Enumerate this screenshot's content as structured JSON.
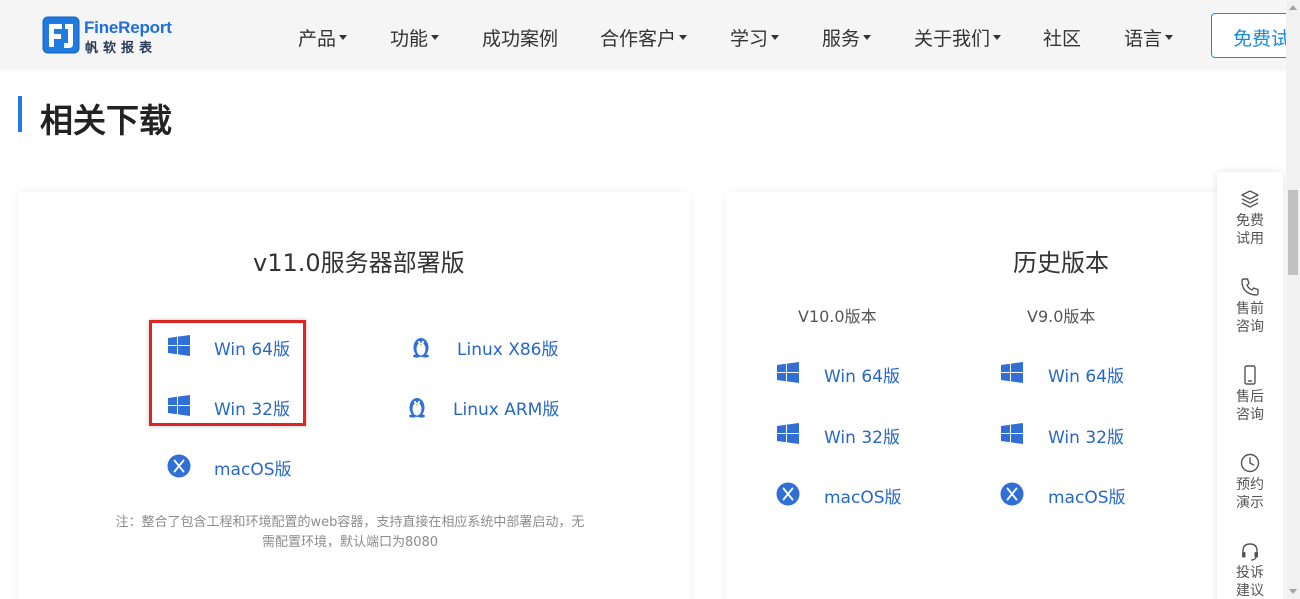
{
  "header": {
    "logo": {
      "en": "FineReport",
      "cn": "帆软报表"
    },
    "nav": [
      {
        "label": "产品",
        "dropdown": true
      },
      {
        "label": "功能",
        "dropdown": true
      },
      {
        "label": "成功案例",
        "dropdown": false
      },
      {
        "label": "合作客户",
        "dropdown": true
      },
      {
        "label": "学习",
        "dropdown": true
      },
      {
        "label": "服务",
        "dropdown": true
      },
      {
        "label": "关于我们",
        "dropdown": true
      },
      {
        "label": "社区",
        "dropdown": false
      },
      {
        "label": "语言",
        "dropdown": true
      }
    ],
    "trial_button": "免费试"
  },
  "page": {
    "title": "相关下载"
  },
  "server_card": {
    "heading": "v11.0服务器部署版",
    "links": {
      "win64": "Win 64版",
      "win32": "Win 32版",
      "macos": "macOS版",
      "linux_x86": "Linux X86版",
      "linux_arm": "Linux ARM版"
    },
    "note": "注：整合了包含工程和环境配置的web容器，支持直接在相应系统中部署启动，无需配置环境，默认端口为8080"
  },
  "history_card": {
    "heading": "历史版本",
    "columns": [
      {
        "title": "V10.0版本",
        "links": [
          "Win 64版",
          "Win 32版",
          "macOS版"
        ]
      },
      {
        "title": "V9.0版本",
        "links": [
          "Win 64版",
          "Win 32版",
          "macOS版"
        ]
      }
    ]
  },
  "sidebar": [
    {
      "label": "免费试用",
      "icon": "layers-icon"
    },
    {
      "label": "售前咨询",
      "icon": "phone-icon"
    },
    {
      "label": "售后咨询",
      "icon": "mobile-icon"
    },
    {
      "label": "预约演示",
      "icon": "clock-icon"
    },
    {
      "label": "投诉建议",
      "icon": "headset-icon"
    }
  ],
  "colors": {
    "accent": "#2478e6",
    "link": "#2767c9",
    "highlight": "#e02424"
  }
}
